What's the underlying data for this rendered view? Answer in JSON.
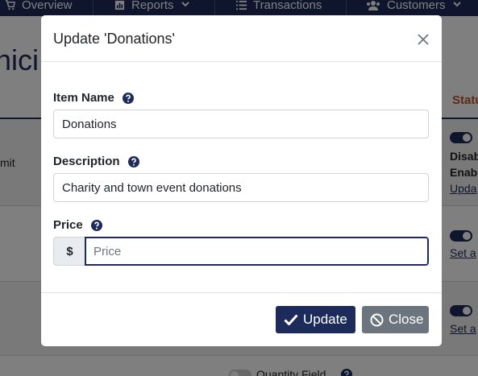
{
  "nav": {
    "items": [
      {
        "label": "Overview",
        "icon": "cart-icon"
      },
      {
        "label": "Reports",
        "icon": "bar-chart-icon"
      },
      {
        "label": "Transactions",
        "icon": "list-icon"
      },
      {
        "label": "Customers",
        "icon": "users-icon"
      }
    ]
  },
  "page": {
    "title_fragment": "nici",
    "status_header": "Statu",
    "row1": {
      "left_text": "mit",
      "state1": "Disab",
      "state2": "Enab",
      "link": "Upda"
    },
    "row2": {
      "link": "Set a"
    },
    "row3": {
      "link": "Set a"
    },
    "row4": {
      "text": "Quantity Field"
    }
  },
  "modal": {
    "title": "Update 'Donations'",
    "fields": {
      "item_name": {
        "label": "Item Name",
        "value": "Donations"
      },
      "description": {
        "label": "Description",
        "value": "Charity and town event donations"
      },
      "price": {
        "label": "Price",
        "prefix": "$",
        "value": "",
        "placeholder": "Price"
      }
    },
    "buttons": {
      "update": "Update",
      "close": "Close"
    }
  },
  "colors": {
    "primary": "#1c2b5a",
    "secondary": "#6c757d",
    "accent_header": "#c0522e"
  }
}
